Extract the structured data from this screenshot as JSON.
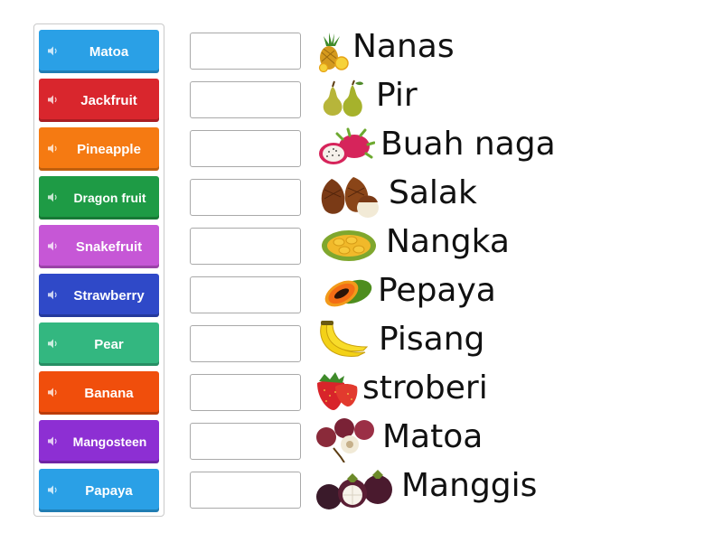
{
  "tiles": [
    {
      "label": "Matoa",
      "color": "#2aa0e6"
    },
    {
      "label": "Jackfruit",
      "color": "#d9262d"
    },
    {
      "label": "Pineapple",
      "color": "#f57a12"
    },
    {
      "label": "Dragon fruit",
      "color": "#1e9b45"
    },
    {
      "label": "Snakefruit",
      "color": "#c657d6"
    },
    {
      "label": "Strawberry",
      "color": "#2f49c8"
    },
    {
      "label": "Pear",
      "color": "#33b780"
    },
    {
      "label": "Banana",
      "color": "#f04e0c"
    },
    {
      "label": "Mangosteen",
      "color": "#8d2fd3"
    },
    {
      "label": "Papaya",
      "color": "#2aa0e6"
    }
  ],
  "targets": [
    {
      "word": "Nanas",
      "icon": "pineapple-icon"
    },
    {
      "word": "Pir",
      "icon": "pear-icon"
    },
    {
      "word": "Buah naga",
      "icon": "dragon-fruit-icon"
    },
    {
      "word": "Salak",
      "icon": "snakefruit-icon"
    },
    {
      "word": "Nangka",
      "icon": "jackfruit-icon"
    },
    {
      "word": "Pepaya",
      "icon": "papaya-icon"
    },
    {
      "word": "Pisang",
      "icon": "banana-icon"
    },
    {
      "word": "stroberi",
      "icon": "strawberry-icon"
    },
    {
      "word": "Matoa",
      "icon": "matoa-icon"
    },
    {
      "word": "Manggis",
      "icon": "mangosteen-icon"
    }
  ]
}
